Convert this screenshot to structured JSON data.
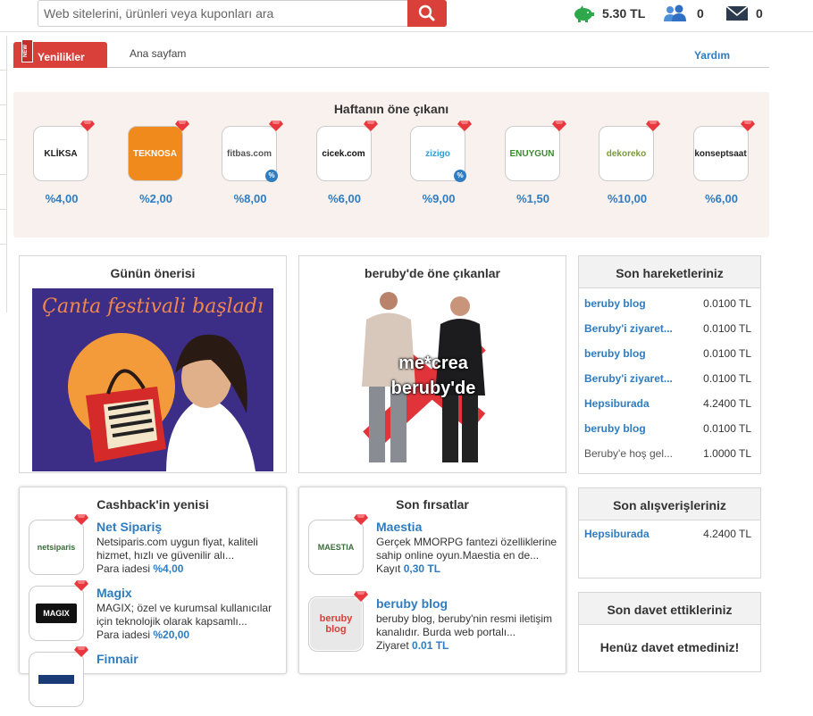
{
  "search": {
    "placeholder": "Web sitelerini, ürünleri veya kuponları ara"
  },
  "stats": {
    "balance": "5.30 TL",
    "invites": "0",
    "messages": "0"
  },
  "tabs": {
    "badge": "NEW",
    "active": "Yenilikler",
    "home": "Ana sayfam",
    "help": "Yardım"
  },
  "featured": {
    "title": "Haftanın öne çıkanı",
    "brands": [
      {
        "logo": "KLİKSA",
        "pct": "%4,00",
        "color": "#1a1a1a",
        "bg": "#ffffff",
        "discount": false
      },
      {
        "logo": "TEKNOSA",
        "pct": "%2,00",
        "color": "#ffffff",
        "bg": "#f08a1c",
        "discount": false
      },
      {
        "logo": "fitbas.com",
        "pct": "%8,00",
        "color": "#555555",
        "bg": "#ffffff",
        "discount": true
      },
      {
        "logo": "cicek.com",
        "pct": "%6,00",
        "color": "#111111",
        "bg": "#ffffff",
        "discount": false
      },
      {
        "logo": "zizigo",
        "pct": "%9,00",
        "color": "#2e9fd6",
        "bg": "#ffffff",
        "discount": true
      },
      {
        "logo": "ENUYGUN",
        "pct": "%1,50",
        "color": "#3a8a2e",
        "bg": "#ffffff",
        "discount": false
      },
      {
        "logo": "dekoreko",
        "pct": "%10,00",
        "color": "#7a9a3a",
        "bg": "#ffffff",
        "discount": false
      },
      {
        "logo": "konseptsaat",
        "pct": "%6,00",
        "color": "#222222",
        "bg": "#ffffff",
        "discount": false
      }
    ]
  },
  "daily": {
    "title": "Günün önerisi",
    "banner_text": "Çanta festivali başladı"
  },
  "highlights": {
    "title": "beruby'de öne çıkanlar",
    "overlay": "me*crea\nberuby'de"
  },
  "activity": {
    "title": "Son hareketleriniz",
    "rows": [
      {
        "name": "beruby blog",
        "amount": "0.0100 TL",
        "link": true
      },
      {
        "name": "Beruby'i ziyaret...",
        "amount": "0.0100 TL",
        "link": true
      },
      {
        "name": "beruby blog",
        "amount": "0.0100 TL",
        "link": true
      },
      {
        "name": "Beruby'i ziyaret...",
        "amount": "0.0100 TL",
        "link": true
      },
      {
        "name": "Hepsiburada",
        "amount": "4.2400 TL",
        "link": true
      },
      {
        "name": "beruby blog",
        "amount": "0.0100 TL",
        "link": true
      },
      {
        "name": "Beruby'e hoş gel...",
        "amount": "1.0000 TL",
        "link": false
      }
    ]
  },
  "purchases": {
    "title": "Son alışverişleriniz",
    "rows": [
      {
        "name": "Hepsiburada",
        "amount": "4.2400 TL"
      }
    ]
  },
  "invitations": {
    "title": "Son davet ettikleriniz",
    "empty": "Henüz davet etmediniz!"
  },
  "cashback": {
    "title": "Cashback'in yenisi",
    "items": [
      {
        "name": "Net Sipariş",
        "logo": "netsiparis",
        "desc": "Netsiparis.com uygun fiyat, kaliteli hizmet, hızlı ve güvenilir alı...",
        "foot_label": "Para iadesi",
        "foot_value": "%4,00"
      },
      {
        "name": "Magix",
        "logo": "MAGIX",
        "desc": "MAGIX; özel ve kurumsal kullanıcılar için teknolojik olarak kapsamlı...",
        "foot_label": "Para iadesi",
        "foot_value": "%20,00"
      },
      {
        "name": "Finnair",
        "logo": "",
        "desc": "",
        "foot_label": "",
        "foot_value": ""
      }
    ]
  },
  "opportunities": {
    "title": "Son fırsatlar",
    "items": [
      {
        "name": "Maestia",
        "logo": "MAESTIA",
        "desc": "Gerçek MMORPG fantezi özelliklerine sahip online oyun.Maestia en de...",
        "foot_label": "Kayıt",
        "foot_value": "0,30 TL"
      },
      {
        "name": "beruby blog",
        "logo": "beruby blog",
        "desc": "beruby blog, beruby'nin resmi iletişim kanalıdır. Burda web portalı...",
        "foot_label": "Ziyaret",
        "foot_value": "0.01 TL"
      }
    ]
  }
}
